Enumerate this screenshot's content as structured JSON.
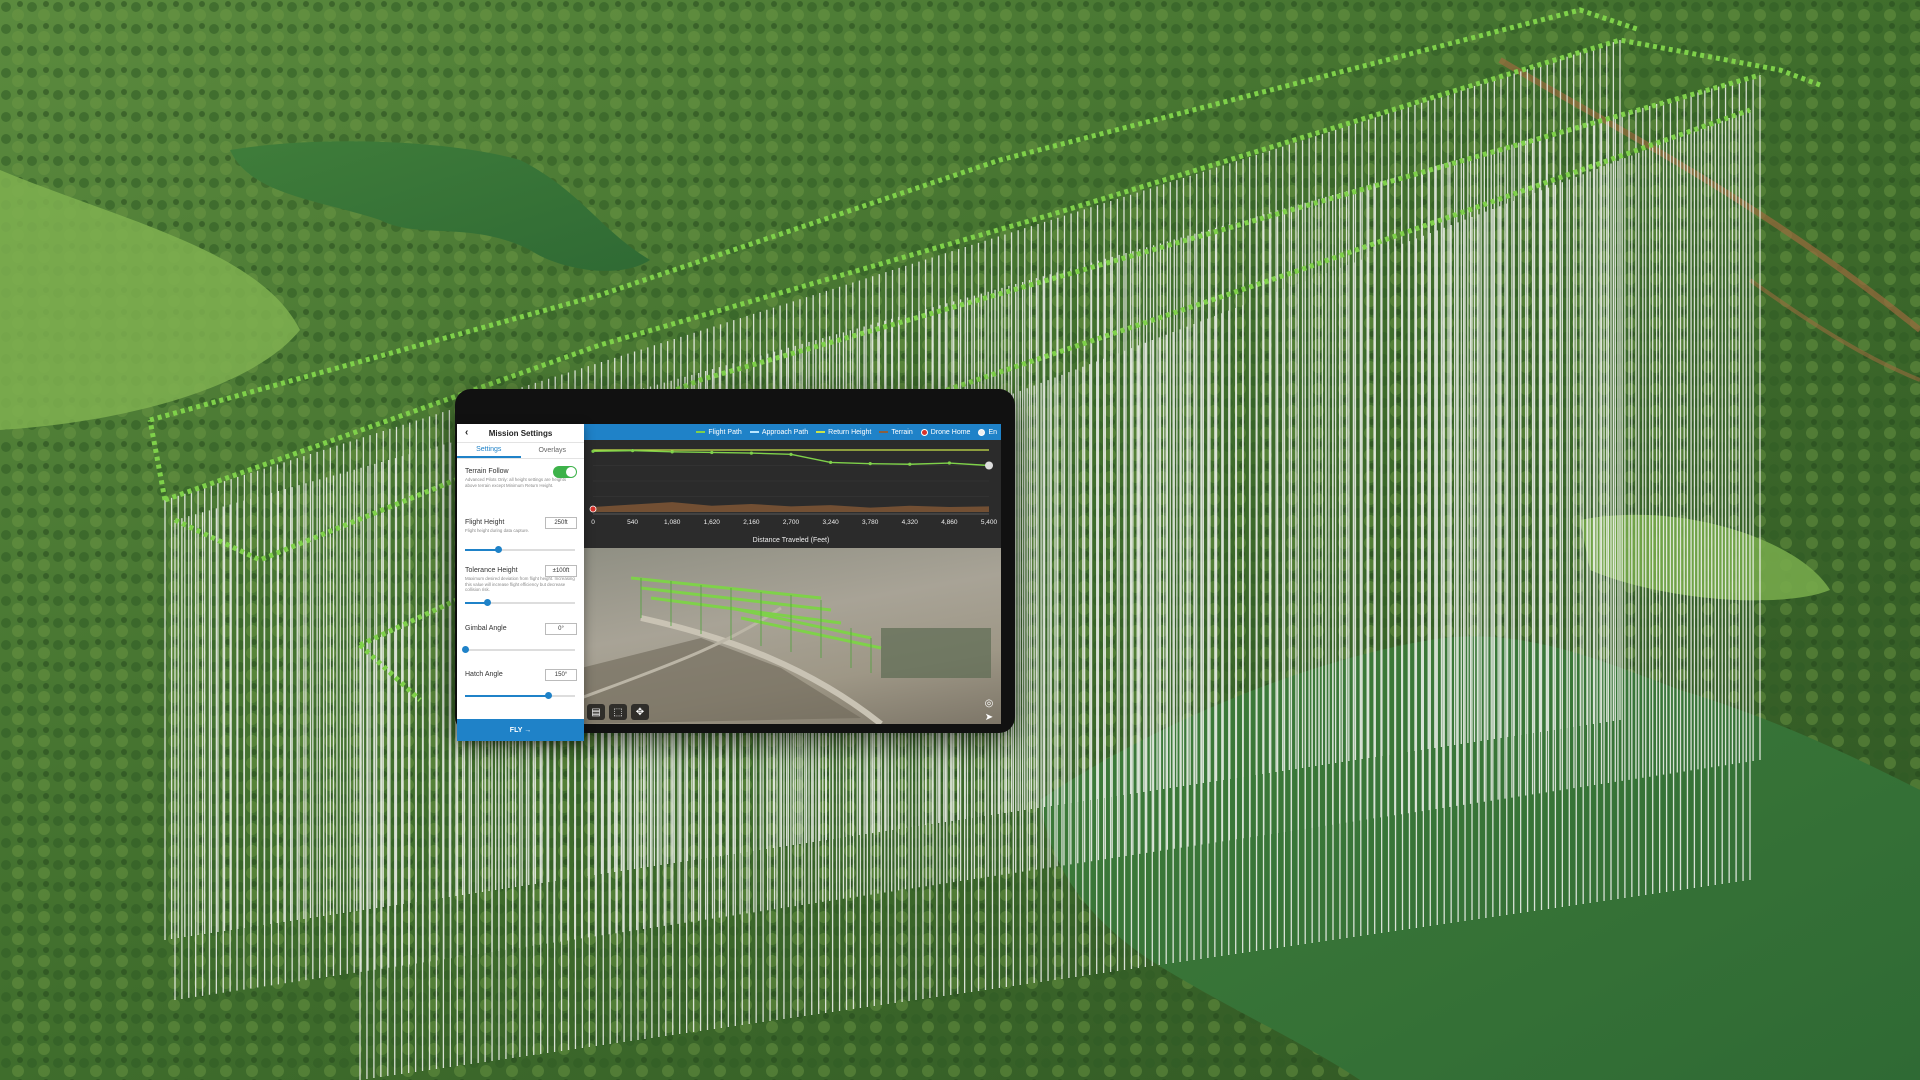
{
  "legend": {
    "flight_path": "Flight Path",
    "approach_path": "Approach Path",
    "return_height": "Return Height",
    "terrain": "Terrain",
    "drone_home": "Drone Home",
    "extra": "En"
  },
  "chart_data": {
    "type": "line",
    "xlabel": "Distance Traveled (Feet)",
    "x_ticks": [
      "0",
      "540",
      "1,080",
      "1,620",
      "2,160",
      "2,700",
      "3,240",
      "3,780",
      "4,320",
      "4,860",
      "5,400"
    ],
    "xlim": [
      0,
      5400
    ],
    "series": [
      {
        "name": "Return Height",
        "x": [
          0,
          5400
        ],
        "y": [
          1.0,
          1.0
        ]
      },
      {
        "name": "Flight Path",
        "x": [
          0,
          540,
          1080,
          1620,
          2160,
          2700,
          3240,
          3780,
          4320,
          4860,
          5400
        ],
        "y": [
          0.98,
          0.99,
          0.97,
          0.96,
          0.95,
          0.93,
          0.8,
          0.78,
          0.77,
          0.79,
          0.75
        ]
      },
      {
        "name": "Terrain",
        "x": [
          0,
          540,
          1080,
          1620,
          2160,
          2700,
          3240,
          3780,
          4320,
          4860,
          5400
        ],
        "y": [
          0.08,
          0.12,
          0.16,
          0.1,
          0.13,
          0.09,
          0.11,
          0.07,
          0.1,
          0.08,
          0.09
        ]
      }
    ]
  },
  "panel": {
    "title": "Mission Settings",
    "tabs": [
      "Settings",
      "Overlays"
    ],
    "terrain_follow": {
      "label": "Terrain Follow",
      "enabled": true,
      "desc": "Advanced Pilots Only: all height settings are heights above terrain except Minimum Return Height."
    },
    "flight_height": {
      "label": "Flight Height",
      "value": "250ft",
      "desc": "Flight height during data capture.",
      "level": 0.3
    },
    "tolerance_height": {
      "label": "Tolerance Height",
      "value": "±100ft",
      "desc": "Maximum desired deviation from flight height. Increasing this value will increase flight efficiency but decrease collision risk.",
      "level": 0.2
    },
    "gimbal_angle": {
      "label": "Gimbal Angle",
      "value": "0°",
      "level": 0.0
    },
    "hatch_angle": {
      "label": "Hatch Angle",
      "value": "150°",
      "level": 0.75
    },
    "fly_label": "FLY →"
  },
  "icons": {
    "back": "chevron-left-icon",
    "drone_home": "home-marker-icon",
    "map_tools": [
      "layers-icon",
      "frame-icon",
      "move-icon"
    ],
    "map_side": [
      "locate-icon",
      "navigate-icon"
    ]
  },
  "colors": {
    "accent": "#1f82c8",
    "flight_path": "#7fd14a",
    "toggle_on": "#3db24a",
    "drone_home": "#d9322b"
  }
}
